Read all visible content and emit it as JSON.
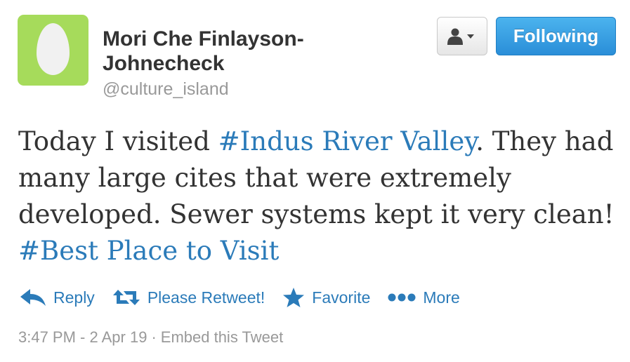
{
  "profile": {
    "name_line1": "Mori Che Finlayson-",
    "name_line2": "Johnecheck",
    "handle": "@culture_island",
    "avatar_color": "#a6db5b"
  },
  "header_actions": {
    "user_menu_icon": "user-dropdown-icon",
    "follow_label": "Following",
    "follow_color": "#2a8ed8"
  },
  "tweet": {
    "seg1": "Today I visited ",
    "tag1": "#Indus River Valley",
    "seg2": ". They had many large cites that were extremely developed. Sewer systems kept it very clean! ",
    "tag2": "#Best Place to Visit",
    "link_color": "#2b7bb9"
  },
  "actions": [
    {
      "icon": "reply-icon",
      "label": "Reply"
    },
    {
      "icon": "retweet-icon",
      "label": "Please Retweet!"
    },
    {
      "icon": "star-icon",
      "label": "Favorite"
    },
    {
      "icon": "more-dots-icon",
      "label": "More"
    }
  ],
  "meta": {
    "timestamp": "3:47 PM - 2 Apr 19",
    "separator": "·",
    "embed": "Embed this Tweet"
  }
}
